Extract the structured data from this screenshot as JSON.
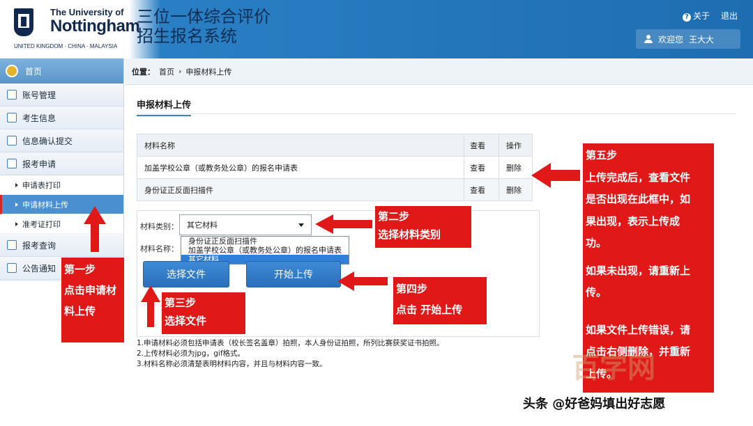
{
  "header": {
    "logo_line1": "The University of",
    "logo_line2": "Nottingham",
    "logo_line3": "UNITED KINGDOM · CHINA · MALAYSIA",
    "title_line1": "三位一体综合评价",
    "title_line2": "招生报名系统",
    "help_label": "关于",
    "logout_label": "退出",
    "welcome": "欢迎您",
    "username": "王大大"
  },
  "sidebar": {
    "home": "首页",
    "items": [
      {
        "label": "账号管理",
        "icon": "account-icon"
      },
      {
        "label": "考生信息",
        "icon": "chat-icon"
      },
      {
        "label": "信息确认提交",
        "icon": "edit-icon"
      },
      {
        "label": "报考申请",
        "icon": "calendar-icon"
      }
    ],
    "subitems": [
      {
        "label": "申请表打印"
      },
      {
        "label": "申请材料上传"
      },
      {
        "label": "准考证打印"
      }
    ],
    "items2": [
      {
        "label": "报考查询",
        "icon": "calendar-icon"
      },
      {
        "label": "公告通知",
        "icon": "notice-icon"
      }
    ]
  },
  "breadcrumb": {
    "label": "位置：",
    "home": "首页",
    "current": "申报材料上传"
  },
  "page": {
    "heading": "申报材料上传"
  },
  "table": {
    "headers": [
      "材料名称",
      "查看",
      "操作"
    ],
    "rows": [
      {
        "name": "加盖学校公章（或教务处公章）的报名申请表",
        "view": "查看",
        "op": "删除"
      },
      {
        "name": "身份证正反面扫描件",
        "view": "查看",
        "op": "删除"
      }
    ]
  },
  "upload": {
    "type_label": "材料类别：",
    "type_value": "其它材料",
    "options": [
      "身份证正反面扫描件",
      "加盖学校公章（或教务处公章）的报名申请表",
      "其它材料"
    ],
    "name_label": "材料名称：",
    "choose_btn": "选择文件",
    "start_btn": "开始上传"
  },
  "notes": [
    "1.申请材料必须包括申请表（校长签名盖章）拍照，本人身份证拍照，所列比赛获奖证书拍照。",
    "2.上传材料必须为jpg，gif格式。",
    "3.材料名称必须清楚表明材料内容，并且与材料内容一致。"
  ],
  "annotations": {
    "step1": [
      "第一步",
      "点击申请材",
      "料上传"
    ],
    "step2": [
      "第二步",
      "选择材料类别"
    ],
    "step3": [
      "第三步",
      "选择文件"
    ],
    "step4": [
      "第四步",
      "点击 开始上传"
    ],
    "step5": [
      "第五步",
      "上传完成后，查看文件",
      "是否出现在此框中，如",
      "果出现，表示上传成",
      "功。",
      "",
      "如果未出现，请重新上",
      "传。",
      "",
      "",
      "如果文件上传错误，请",
      "点击右侧删除，并重新",
      "上传。"
    ]
  },
  "watermark": "头条 @好爸妈填出好志愿",
  "watermark_logo": "百字网",
  "colors": {
    "accent": "#2a7fc4",
    "annotation": "#e01818"
  }
}
